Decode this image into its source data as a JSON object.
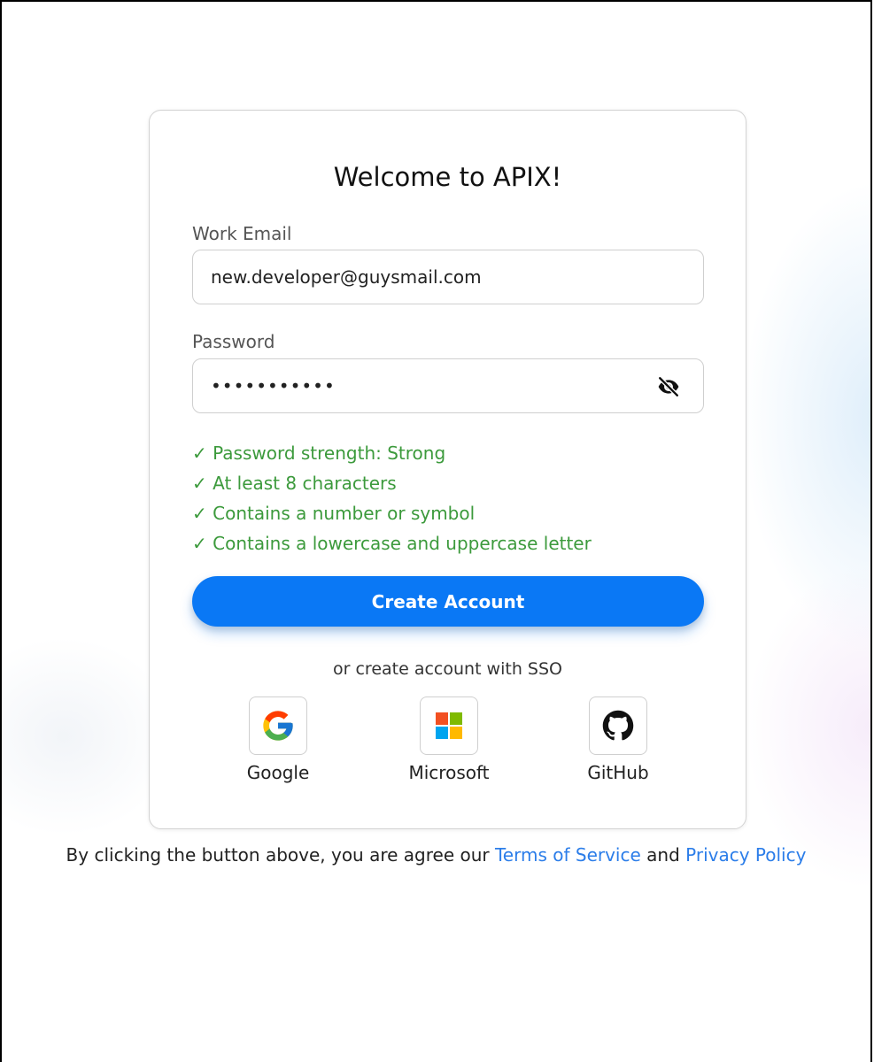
{
  "form": {
    "title": "Welcome to APIX!",
    "email_label": "Work Email",
    "email_value": "new.developer@guysmail.com",
    "password_label": "Password",
    "password_value": "•••••••••••",
    "password_toggle_icon": "eye-off-icon"
  },
  "validation": [
    "✓ Password strength: Strong",
    "✓ At least 8 characters",
    "✓ Contains a number or symbol",
    "✓ Contains a lowercase and uppercase letter"
  ],
  "cta_label": "Create Account",
  "sso": {
    "prompt": "or create account with SSO",
    "providers": [
      {
        "name": "Google",
        "icon": "google-icon"
      },
      {
        "name": "Microsoft",
        "icon": "microsoft-icon"
      },
      {
        "name": "GitHub",
        "icon": "github-icon"
      }
    ]
  },
  "legal": {
    "prefix": "By clicking the button above, you are agree our ",
    "terms": "Terms of Service",
    "middle": " and ",
    "privacy": "Privacy Policy"
  },
  "colors": {
    "accent": "#0a78f5",
    "success": "#3c9a3c",
    "link": "#2b7de9"
  }
}
